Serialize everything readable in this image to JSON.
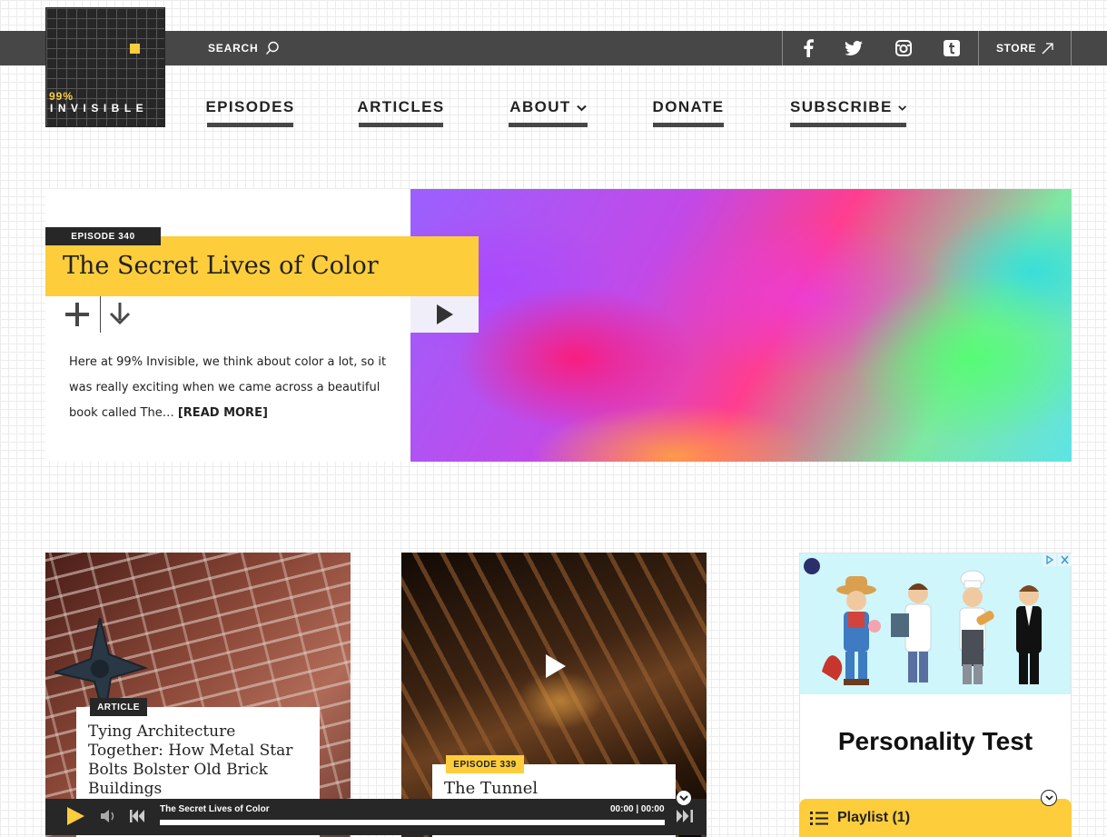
{
  "logo": {
    "line1": "99%",
    "line2": "INVISIBLE"
  },
  "topbar": {
    "search_label": "SEARCH",
    "social": [
      "facebook-icon",
      "twitter-icon",
      "instagram-icon",
      "tumblr-icon"
    ],
    "store_label": "STORE"
  },
  "nav": {
    "items": [
      {
        "label": "EPISODES"
      },
      {
        "label": "ARTICLES"
      },
      {
        "label": "ABOUT"
      },
      {
        "label": "DONATE"
      },
      {
        "label": "SUBSCRIBE"
      }
    ]
  },
  "hero": {
    "episode_label": "EPISODE 340",
    "title": "The Secret Lives of Color",
    "description": "Here at 99% Invisible, we think about color a lot, so it was really exciting when we came across a beautiful book called The…",
    "read_more": "[READ MORE]"
  },
  "cards": [
    {
      "label": "ARTICLE",
      "title": "Tying Architecture Together: How Metal Star Bolts Bolster Old Brick Buildings"
    },
    {
      "label": "EPISODE 339",
      "title": "The Tunnel"
    }
  ],
  "ad": {
    "title": "Personality Test"
  },
  "player": {
    "track_title": "The Secret Lives of Color",
    "time": "00:00 | 00:00"
  },
  "playlist": {
    "label": "Playlist (1)"
  },
  "colors": {
    "accent": "#fdcd3b",
    "dark": "#272727",
    "bar": "#474747"
  }
}
